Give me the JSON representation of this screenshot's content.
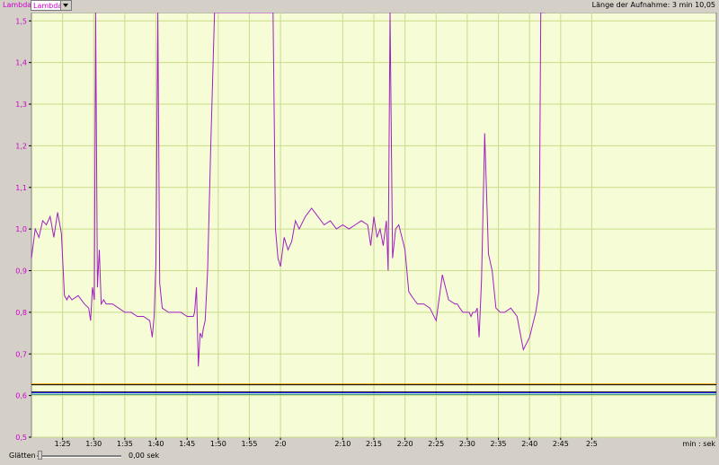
{
  "header": {
    "axis_label": "Lambda",
    "channel_select": "Lambda",
    "recording_length": "Länge der Aufnahme: 3 min 10,05"
  },
  "footer": {
    "smooth_label": "Glätten",
    "smooth_value": "0,00 sek"
  },
  "colors": {
    "plot_bg": "#f5fcd6",
    "grid": "#c9dc8a",
    "lambda": "#a020c0",
    "axis_text": "#cc00cc"
  },
  "chart_data": {
    "type": "line",
    "x_unit": "min : sek",
    "x_ticks": [
      "1:25",
      "1:30",
      "1:35",
      "1:40",
      "1:45",
      "1:50",
      "1:55",
      "2:0",
      "2:5",
      "2:10",
      "2:15",
      "2:20",
      "2:25",
      "2:30",
      "2:35",
      "2:40",
      "2:45"
    ],
    "y_ticks": [
      "0,5",
      "0,6",
      "0,7",
      "0,8",
      "0,9",
      "1,0",
      "1,1",
      "1,2",
      "1,3",
      "1,4",
      "1,5"
    ],
    "ylim": [
      0.5,
      1.52
    ],
    "xlim_sec": [
      80,
      190
    ],
    "series": [
      {
        "name": "Lambda",
        "color": "#a020c0",
        "x_sec": [
          80,
          80.6,
          81.2,
          81.8,
          82.4,
          83,
          83.6,
          84.2,
          84.8,
          85.3,
          85.7,
          86.0,
          86.5,
          87.5,
          88.5,
          89.2,
          89.5,
          89.8,
          90.1,
          90.3,
          90.6,
          90.9,
          91.2,
          91.6,
          92,
          93,
          94,
          95,
          96,
          97,
          98,
          99,
          99.4,
          99.7,
          100,
          100.3,
          100.6,
          101,
          102,
          103,
          104,
          105,
          106,
          106.2,
          106.5,
          106.8,
          107.1,
          107.4,
          107.6,
          107.9,
          108.3,
          108.8,
          109.4,
          110,
          116,
          118.8,
          119.2,
          119.6,
          120,
          120.6,
          121.2,
          121.8,
          122.4,
          123,
          124,
          125,
          126,
          127,
          128,
          129,
          130,
          131,
          132,
          133,
          134,
          134.5,
          135,
          135.5,
          136,
          136.5,
          137,
          137.3,
          137.6,
          138,
          138.5,
          139,
          139.5,
          140,
          140.6,
          141,
          141.5,
          142,
          143,
          144,
          145,
          146,
          147,
          148,
          148.4,
          148.8,
          149.3,
          149.9,
          150.3,
          150.6,
          150.9,
          151.3,
          151.6,
          151.9,
          152.3,
          152.8,
          153.4,
          154,
          154.6,
          155.3,
          156,
          157,
          158,
          159,
          160,
          161,
          161.5,
          161.8,
          162.1,
          162.5,
          163,
          164,
          165,
          166,
          167,
          167.5,
          167.8,
          168,
          168.3,
          168.6,
          169,
          169.5,
          170,
          170.5,
          171,
          171.3,
          171.6,
          172,
          173,
          174,
          175,
          180,
          190
        ],
        "values": [
          0.93,
          1.0,
          0.98,
          1.02,
          1.01,
          1.03,
          0.98,
          1.04,
          0.99,
          0.84,
          0.83,
          0.84,
          0.83,
          0.84,
          0.82,
          0.81,
          0.78,
          0.86,
          0.83,
          1.52,
          0.86,
          0.95,
          0.82,
          0.83,
          0.82,
          0.82,
          0.81,
          0.8,
          0.8,
          0.79,
          0.79,
          0.78,
          0.74,
          0.79,
          0.92,
          1.52,
          0.87,
          0.81,
          0.8,
          0.8,
          0.8,
          0.79,
          0.79,
          0.8,
          0.86,
          0.67,
          0.75,
          0.74,
          0.76,
          0.78,
          0.9,
          1.2,
          1.52,
          1.52,
          1.52,
          1.52,
          1.0,
          0.93,
          0.91,
          0.98,
          0.95,
          0.97,
          1.02,
          1.0,
          1.03,
          1.05,
          1.03,
          1.01,
          1.02,
          1.0,
          1.01,
          1.0,
          1.01,
          1.02,
          1.01,
          0.96,
          1.03,
          0.98,
          1.0,
          0.96,
          1.02,
          0.9,
          1.52,
          0.93,
          1.0,
          1.01,
          0.98,
          0.95,
          0.85,
          0.84,
          0.83,
          0.82,
          0.82,
          0.81,
          0.78,
          0.89,
          0.83,
          0.82,
          0.82,
          0.81,
          0.8,
          0.8,
          0.8,
          0.79,
          0.8,
          0.8,
          0.81,
          0.74,
          0.88,
          1.23,
          0.94,
          0.9,
          0.81,
          0.8,
          0.8,
          0.81,
          0.79,
          0.71,
          0.74,
          0.8,
          0.85,
          1.52,
          1.52,
          1.52
        ]
      }
    ],
    "baselines": [
      {
        "color": "#f0a000",
        "value": 0.628
      },
      {
        "color": "#000000",
        "value": 0.626
      },
      {
        "color": "#0000ff",
        "value": 0.607
      },
      {
        "color": "#008080",
        "value": 0.603
      },
      {
        "color": "#2a2a2a",
        "value": 0.609
      }
    ]
  }
}
